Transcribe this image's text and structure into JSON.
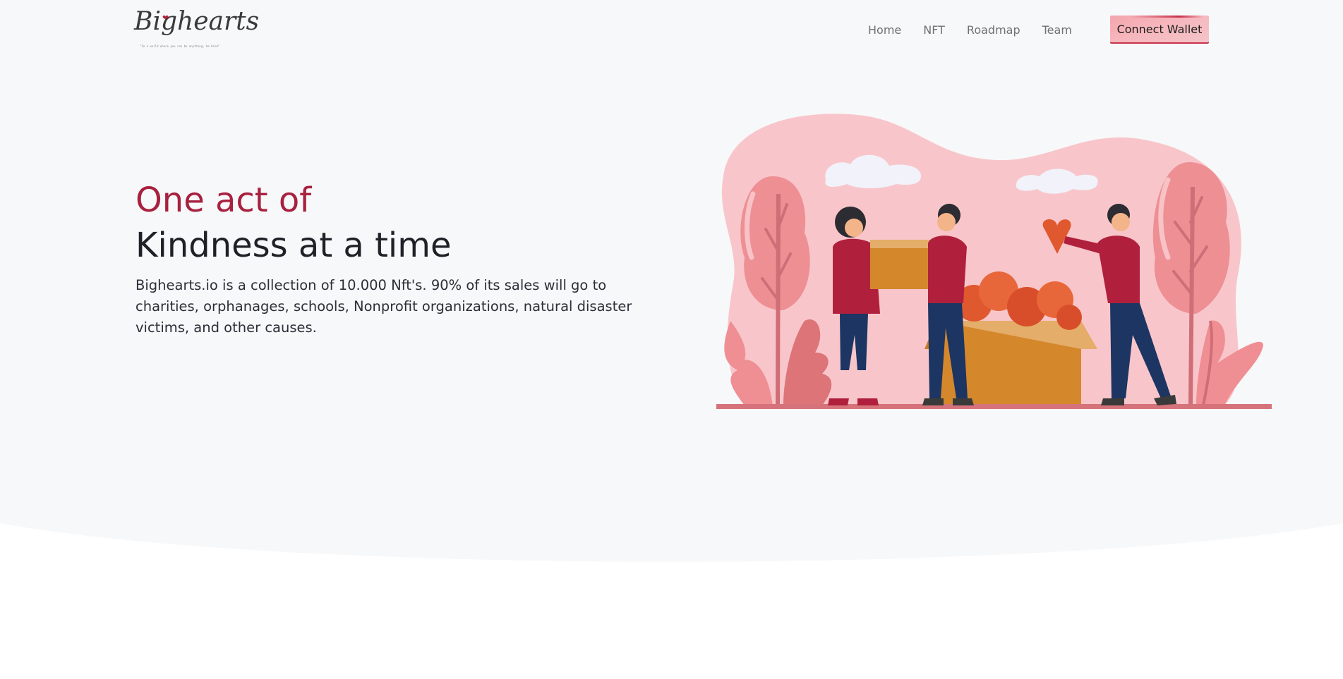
{
  "brand": {
    "logo_text": "Bighearts",
    "tagline": "\"In a world where you can be anything, be kind\""
  },
  "nav": {
    "items": [
      {
        "label": "Home"
      },
      {
        "label": "NFT"
      },
      {
        "label": "Roadmap"
      },
      {
        "label": "Team"
      }
    ],
    "connect_label": "Connect Wallet"
  },
  "hero": {
    "title_line1": "One act of",
    "title_line2": "Kindness at a time",
    "description": "Bighearts.io is a collection of 10.000 Nft's. 90% of its sales will go to charities, orphanages, schools, Nonprofit organizations, natural disaster victims, and other causes."
  },
  "theme": {
    "accent": "#a8213f",
    "hero_background": "#f7f8fa",
    "button_color": "#f4a5ad",
    "illustration_pink": "#f8c6ca"
  },
  "icons": {
    "illustration": "people-sharing-hearts-illustration",
    "logo_heart": "heart-icon"
  }
}
